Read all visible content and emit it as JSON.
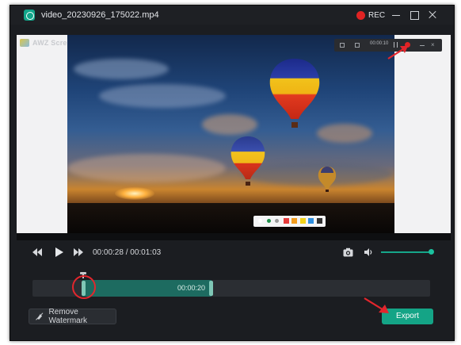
{
  "window": {
    "title": "video_20230926_175022.mp4",
    "rec_label": "REC",
    "icons": [
      "app-logo-icon",
      "rec-dot-icon",
      "minimize-icon",
      "maximize-icon",
      "close-icon"
    ]
  },
  "preview": {
    "watermark_text": "AWZ Screen Recorder",
    "mini_toolbar": {
      "elapsed": "00:00:10",
      "icons": [
        "edit-icon",
        "screenshot-icon",
        "pause-icon",
        "stop-record-icon",
        "minimize-icon",
        "close-icon"
      ]
    },
    "annotation_colors": [
      "#ffffff",
      "#1f8f4a",
      "#9a9a9a",
      "#e53b3b",
      "#f39c1e",
      "#f2d21b",
      "#2f8fe0",
      "#333333"
    ]
  },
  "player": {
    "current_time": "00:00:28",
    "total_time": "00:01:03",
    "volume_level": 1.0,
    "icons": [
      "rewind-icon",
      "play-icon",
      "fast-forward-icon",
      "camera-icon",
      "volume-icon"
    ]
  },
  "timeline": {
    "selection_duration": "00:00:20",
    "colors": {
      "selection": "#1d6b60",
      "handle": "#7fc7b6",
      "annotation_circle": "#e3262d"
    }
  },
  "actions": {
    "remove_watermark_label": "Remove Watermark",
    "export_label": "Export"
  },
  "colors": {
    "accent": "#14a486",
    "record_red": "#e02323",
    "window_bg": "#1b1d21"
  }
}
